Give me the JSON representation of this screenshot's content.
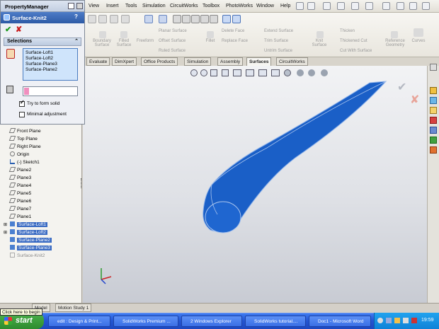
{
  "menu": {
    "items": [
      "View",
      "Insert",
      "Tools",
      "Simulation",
      "CircuitWorks",
      "Toolbox",
      "PhotoWorks",
      "Window",
      "Help"
    ]
  },
  "property_manager": {
    "title": "PropertyManager",
    "feature_name": "Surface-Knit2",
    "ok_label": "✔",
    "cancel_label": "✘",
    "help_label": "?",
    "selections_header": "Selections",
    "selected_items": [
      "Surface-Loft1",
      "Surface-Loft2",
      "Surface-Plane3",
      "Surface-Plane2"
    ],
    "option_try_solid": "Try to form solid",
    "option_try_solid_checked": true,
    "option_minimal": "Minimal adjustment",
    "option_minimal_checked": false
  },
  "command_manager": {
    "buttons": [
      {
        "label": "Boundary Surface"
      },
      {
        "label": "Filled Surface"
      },
      {
        "label": "Freeform"
      },
      {
        "label": "Planar Surface"
      },
      {
        "label": "Offset Surface"
      },
      {
        "label": "Ruled Surface"
      },
      {
        "label": "Fillet"
      },
      {
        "label": "Delete Face"
      },
      {
        "label": "Replace Face"
      },
      {
        "label": "Extend Surface"
      },
      {
        "label": "Trim Surface"
      },
      {
        "label": "Untrim Surface"
      },
      {
        "label": "Knit Surface"
      },
      {
        "label": "Thicken"
      },
      {
        "label": "Thickened Cut"
      },
      {
        "label": "Cut With Surface"
      },
      {
        "label": "Reference Geometry"
      },
      {
        "label": "Curves"
      }
    ]
  },
  "tabs": [
    "Evaluate",
    "DimXpert",
    "Office Products",
    "Simulation",
    "Assembly",
    "Surfaces",
    "CircuitWorks"
  ],
  "active_tab": "Surfaces",
  "feature_tree": [
    "Front Plane",
    "Top Plane",
    "Right Plane",
    "Origin",
    "(-) Sketch1",
    "Plane2",
    "Plane3",
    "Plane4",
    "Plane5",
    "Plane6",
    "Plane7",
    "Plane1",
    "Surface-Loft1",
    "Surface-Loft2",
    "Surface-Plane2",
    "Surface-Plane3",
    "Surface-Knit2"
  ],
  "bottom_tabs": [
    "Model",
    "Motion Study 1"
  ],
  "tooltip": "Click here to begin",
  "taskbar": {
    "start": "start",
    "items": [
      "edit : Design & Print...",
      "SolidWorks Premium ...",
      "2 Windows Explorer",
      "SolidWorks tutorial....",
      "Doc1 - Microsoft Word"
    ],
    "clock": "19:59"
  },
  "colors": {
    "surface": "#1a5fc7",
    "accent": "#3a6bc3",
    "taskbar": "#2456d3",
    "start": "#2e8b2e"
  }
}
